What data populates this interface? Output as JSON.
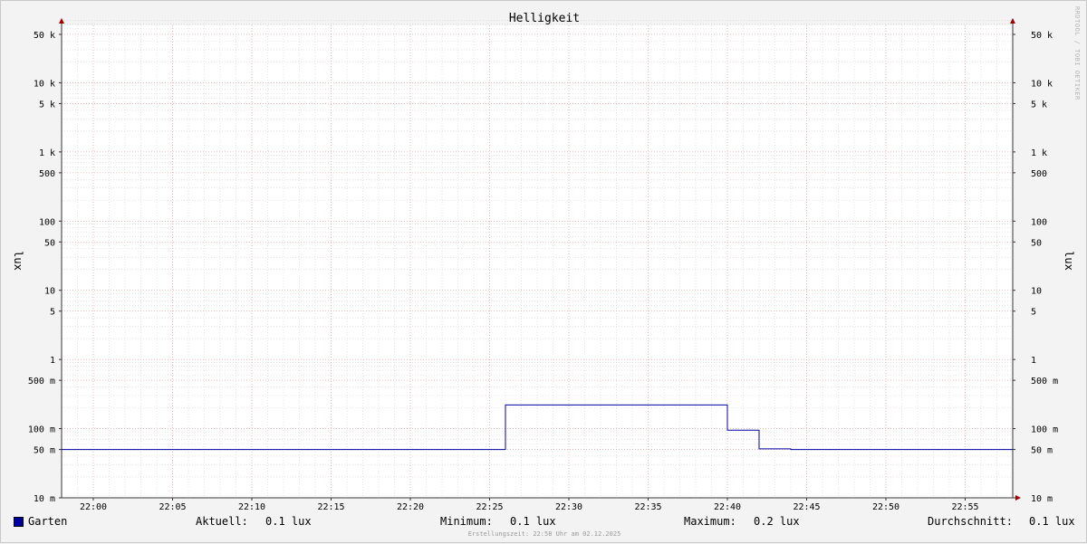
{
  "chart_data": {
    "type": "line",
    "title": "Helligkeit",
    "ylabel": "lux",
    "ylabel_right": "lux",
    "yscale": "log",
    "ylim": [
      0.01,
      80000
    ],
    "xlim": [
      "21:58:00",
      "22:58:00"
    ],
    "x_ticks": [
      "22:00",
      "22:05",
      "22:10",
      "22:15",
      "22:20",
      "22:25",
      "22:30",
      "22:35",
      "22:40",
      "22:45",
      "22:50",
      "22:55"
    ],
    "y_ticks": [
      {
        "value": 50000,
        "label": "50 k"
      },
      {
        "value": 10000,
        "label": "10 k"
      },
      {
        "value": 5000,
        "label": "5 k"
      },
      {
        "value": 1000,
        "label": "1 k"
      },
      {
        "value": 500,
        "label": "500"
      },
      {
        "value": 100,
        "label": "100"
      },
      {
        "value": 50,
        "label": "50"
      },
      {
        "value": 10,
        "label": "10"
      },
      {
        "value": 5,
        "label": "5"
      },
      {
        "value": 1,
        "label": "1"
      },
      {
        "value": 0.5,
        "label": "500 m"
      },
      {
        "value": 0.1,
        "label": "100 m"
      },
      {
        "value": 0.05,
        "label": "50 m"
      },
      {
        "value": 0.01,
        "label": "10 m"
      }
    ],
    "grid": true,
    "series": [
      {
        "name": "Garten",
        "color": "#0000a0",
        "step": true,
        "points": [
          {
            "x": "21:58:00",
            "y": 0.05
          },
          {
            "x": "22:26:00",
            "y": 0.22
          },
          {
            "x": "22:40:00",
            "y": 0.095
          },
          {
            "x": "22:42:00",
            "y": 0.051
          },
          {
            "x": "22:44:00",
            "y": 0.05
          },
          {
            "x": "22:58:00",
            "y": 0.05
          }
        ]
      }
    ]
  },
  "legend": {
    "series_name": "Garten",
    "aktuell_label": "Aktuell:",
    "aktuell_value": "0.1 lux",
    "minimum_label": "Minimum:",
    "minimum_value": "0.1 lux",
    "maximum_label": "Maximum:",
    "maximum_value": "0.2 lux",
    "durchschnitt_label": "Durchschnitt:",
    "durchschnitt_value": "0.1 lux"
  },
  "watermark": "RRDTOOL / TOBI OETIKER",
  "footer": "Erstellungszeit: 22:58 Uhr am 02.12.2025",
  "colors": {
    "series": "#0000a0",
    "major_grid": "#e8a0a0",
    "minor_grid": "#c8c8c8",
    "axis_arrow": "#a00000"
  }
}
